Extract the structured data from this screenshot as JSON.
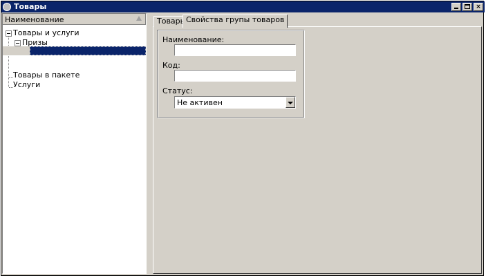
{
  "window": {
    "title": "Товары",
    "controls": {
      "minimize": "_",
      "maximize": "□",
      "close": "×"
    }
  },
  "tree": {
    "column_header": "Наименование",
    "nodes": [
      {
        "label": "Товары и услуги",
        "expanded": true
      },
      {
        "label": "Призы",
        "expanded": true
      },
      {
        "label": "",
        "selected": true
      },
      {
        "label": "Товары в пакете"
      },
      {
        "label": "Услуги"
      }
    ]
  },
  "tabs": [
    {
      "label": "Товары",
      "active": false
    },
    {
      "label": "Свойства групы товаров",
      "active": true
    }
  ],
  "form": {
    "name_label": "Наименование:",
    "name_value": "",
    "code_label": "Код:",
    "code_value": "",
    "status_label": "Статус:",
    "status_value": "Не активен"
  },
  "colors": {
    "titlebar": "#0a246a",
    "face": "#d4d0c8",
    "selection": "#0a246a"
  }
}
